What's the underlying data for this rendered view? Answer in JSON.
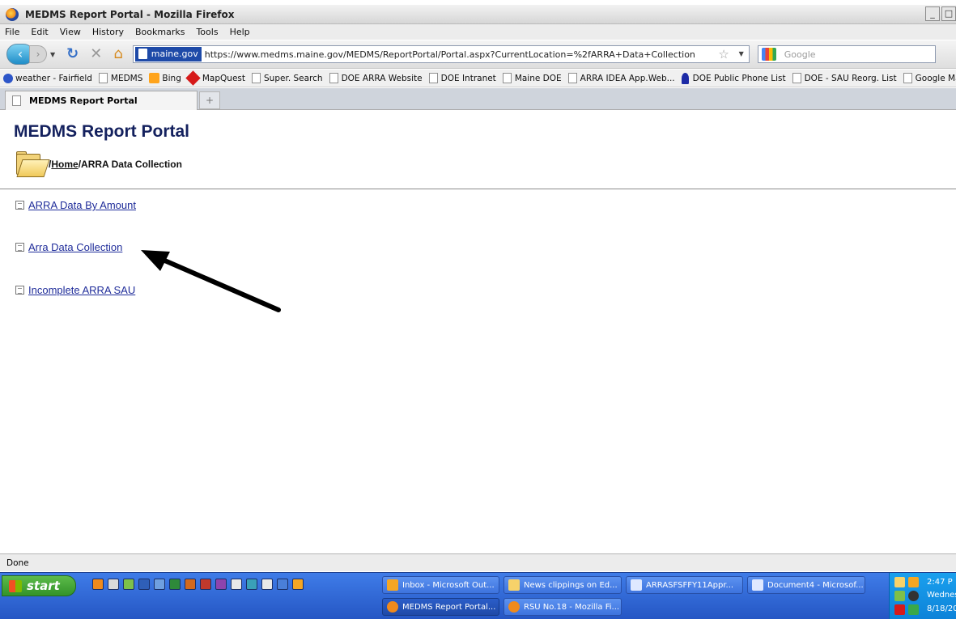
{
  "window": {
    "title": "MEDMS Report Portal - Mozilla Firefox",
    "controls": [
      "_",
      "□"
    ]
  },
  "menu": [
    "File",
    "Edit",
    "View",
    "History",
    "Bookmarks",
    "Tools",
    "Help"
  ],
  "nav": {
    "site_identity": "maine.gov",
    "url": "https://www.medms.maine.gov/MEDMS/ReportPortal/Portal.aspx?CurrentLocation=%2fARRA+Data+Collection",
    "search_placeholder": "Google"
  },
  "bookmarks": [
    "weather - Fairfield",
    "MEDMS",
    "Bing",
    "MapQuest",
    "Super. Search",
    "DOE ARRA Website",
    "DOE Intranet",
    "Maine DOE",
    "ARRA IDEA App.Web...",
    "DOE Public Phone List",
    "DOE - SAU Reorg. List",
    "Google Maps"
  ],
  "tab": {
    "label": "MEDMS Report Portal",
    "new_tab": "+"
  },
  "page": {
    "title": "MEDMS Report Portal",
    "breadcrumb": {
      "sep1": "/",
      "home": "Home",
      "sep2": "/",
      "current": "ARRA Data Collection"
    },
    "reports": [
      "ARRA Data By Amount",
      "Arra Data Collection",
      "Incomplete ARRA SAU"
    ]
  },
  "status": "Done",
  "taskbar": {
    "start": "start",
    "buttons": [
      "Inbox - Microsoft Out...",
      "News clippings on Ed...",
      "ARRASFSFFY11Appr...",
      "Document4 - Microsof...",
      "MEDMS Report Portal...",
      "RSU No.18 - Mozilla Fi..."
    ],
    "clock": "2:47 P",
    "day": "Wednes",
    "date": "8/18/20"
  }
}
